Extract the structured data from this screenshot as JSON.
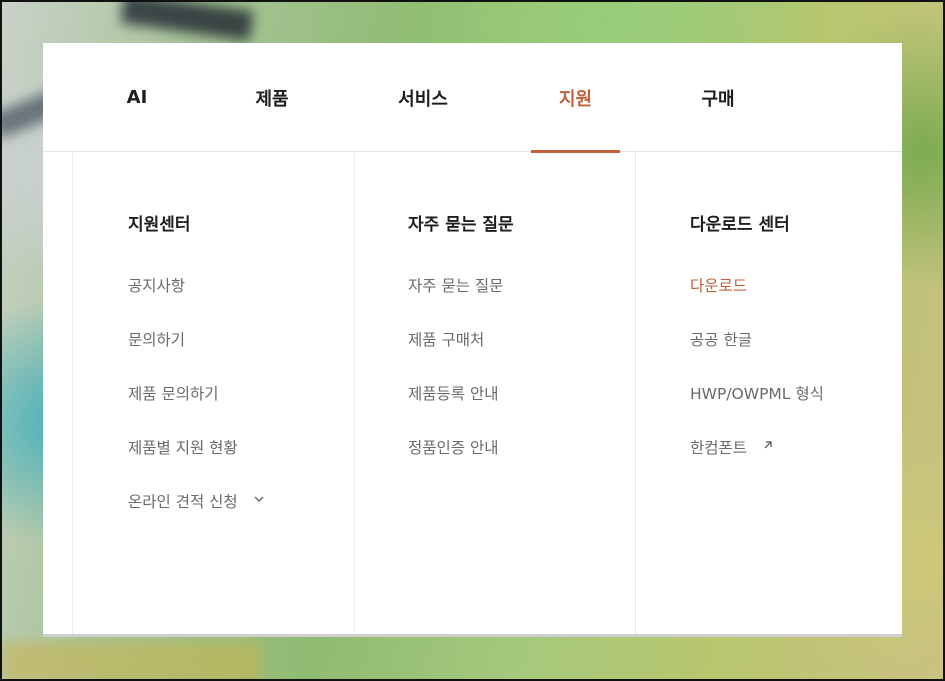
{
  "nav": {
    "items": [
      {
        "label": "AI"
      },
      {
        "label": "제품"
      },
      {
        "label": "서비스"
      },
      {
        "label": "지원",
        "active": true
      },
      {
        "label": "구매"
      }
    ]
  },
  "columns": [
    {
      "title": "지원센터",
      "links": [
        {
          "label": "공지사항"
        },
        {
          "label": "문의하기"
        },
        {
          "label": "제품 문의하기"
        },
        {
          "label": "제품별 지원 현황"
        },
        {
          "label": "온라인 견적 신청",
          "icon": "chevron-down-icon"
        }
      ]
    },
    {
      "title": "자주 묻는 질문",
      "links": [
        {
          "label": "자주 묻는 질문"
        },
        {
          "label": "제품 구매처"
        },
        {
          "label": "제품등록 안내"
        },
        {
          "label": "정품인증 안내"
        }
      ]
    },
    {
      "title": "다운로드 센터",
      "links": [
        {
          "label": "다운로드",
          "highlight": true
        },
        {
          "label": "공공 한글"
        },
        {
          "label": "HWP/OWPML 형식"
        },
        {
          "label": "한컴폰트",
          "icon": "external-link-arrow-icon"
        }
      ]
    }
  ],
  "colors": {
    "accent": "#c2603b",
    "text": "#1e1e1e",
    "muted": "#6a6a6a"
  }
}
